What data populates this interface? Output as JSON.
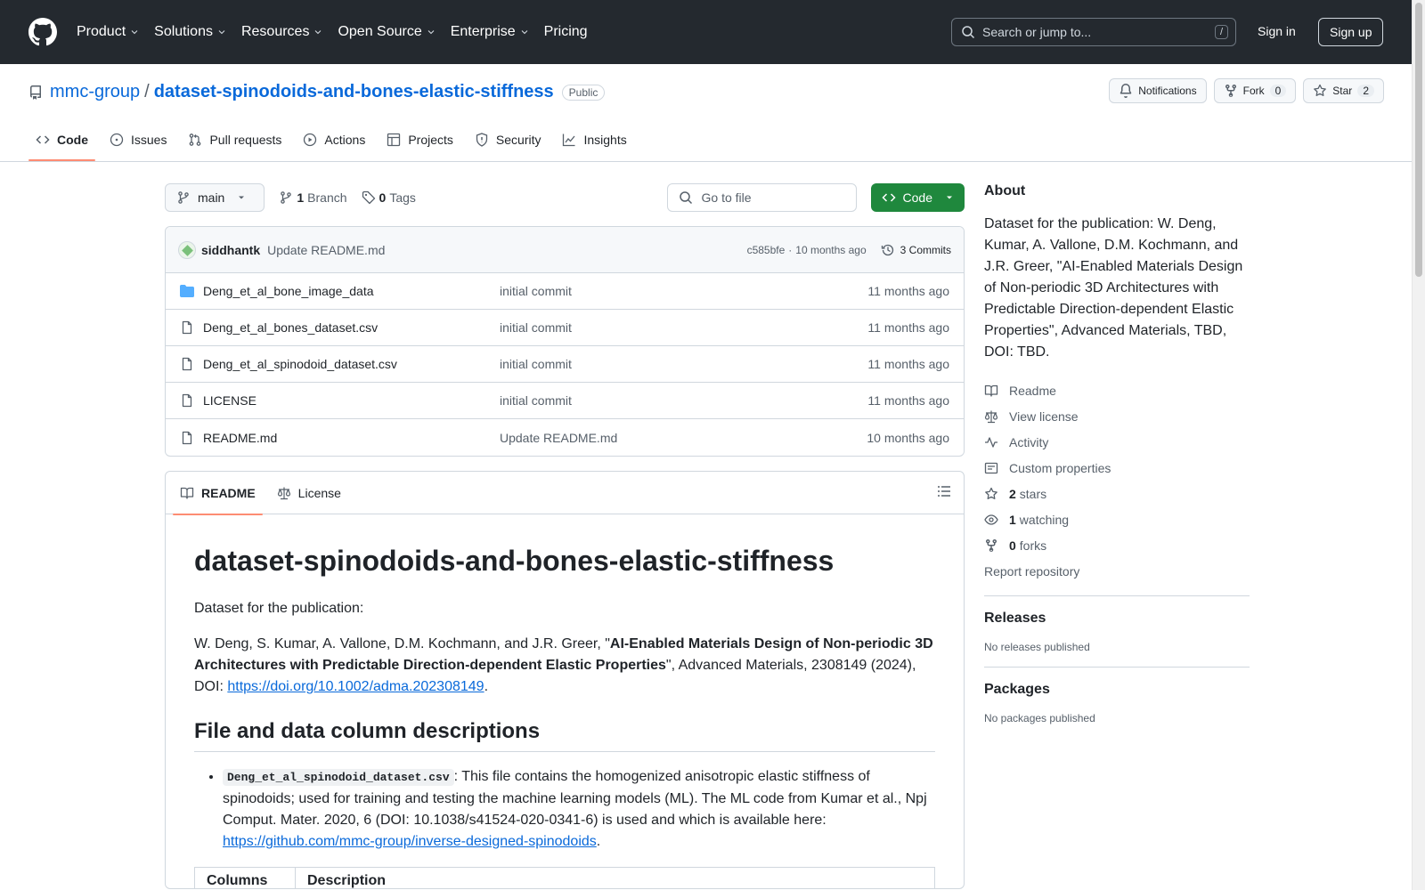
{
  "header": {
    "nav": [
      "Product",
      "Solutions",
      "Resources",
      "Open Source",
      "Enterprise",
      "Pricing"
    ],
    "search_placeholder": "Search or jump to...",
    "search_shortcut": "/",
    "sign_in": "Sign in",
    "sign_up": "Sign up"
  },
  "repo": {
    "owner": "mmc-group",
    "separator": "/",
    "name": "dataset-spinodoids-and-bones-elastic-stiffness",
    "visibility": "Public",
    "notifications_label": "Notifications",
    "fork_label": "Fork",
    "fork_count": "0",
    "star_label": "Star",
    "star_count": "2",
    "tabs": [
      "Code",
      "Issues",
      "Pull requests",
      "Actions",
      "Projects",
      "Security",
      "Insights"
    ]
  },
  "toolbar": {
    "branch": "main",
    "branch_count": "1",
    "branch_label": "Branch",
    "tag_count": "0",
    "tag_label": "Tags",
    "go_to_file": "Go to file",
    "code_button": "Code"
  },
  "commit": {
    "author": "siddhantk",
    "message": "Update README.md",
    "hash": "c585bfe",
    "dot": "·",
    "time": "10 months ago",
    "commits_label": "3 Commits"
  },
  "files": [
    {
      "name": "Deng_et_al_bone_image_data",
      "type": "folder",
      "commit": "initial commit",
      "date": "11 months ago"
    },
    {
      "name": "Deng_et_al_bones_dataset.csv",
      "type": "file",
      "commit": "initial commit",
      "date": "11 months ago"
    },
    {
      "name": "Deng_et_al_spinodoid_dataset.csv",
      "type": "file",
      "commit": "initial commit",
      "date": "11 months ago"
    },
    {
      "name": "LICENSE",
      "type": "file",
      "commit": "initial commit",
      "date": "11 months ago"
    },
    {
      "name": "README.md",
      "type": "file",
      "commit": "Update README.md",
      "date": "10 months ago"
    }
  ],
  "readme": {
    "tab_readme": "README",
    "tab_license": "License",
    "title": "dataset-spinodoids-and-bones-elastic-stiffness",
    "intro": "Dataset for the publication:",
    "citation_authors": "W. Deng, S. Kumar, A. Vallone, D.M. Kochmann, and J.R. Greer, \"",
    "citation_title": "AI-Enabled Materials Design of Non-periodic 3D Architectures with Predictable Direction-dependent Elastic Properties",
    "citation_rest": "\", Advanced Materials, 2308149 (2024), DOI: ",
    "doi_link": "https://doi.org/10.1002/adma.202308149",
    "doi_end": ".",
    "section_heading": "File and data column descriptions",
    "item_code": "Deng_et_al_spinodoid_dataset.csv",
    "item_text": ": This file contains the homogenized anisotropic elastic stiffness of spinodoids; used for training and testing the machine learning models (ML). The ML code from Kumar et al., Npj Comput. Mater. 2020, 6 (DOI: 10.1038/s41524-020-0341-6) is used and which is available here: ",
    "item_link": "https://github.com/mmc-group/inverse-designed-spinodoids",
    "item_end": ".",
    "table_col1": "Columns",
    "table_col2": "Description"
  },
  "sidebar": {
    "about_title": "About",
    "description": "Dataset for the publication: W. Deng, Kumar, A. Vallone, D.M. Kochmann, and J.R. Greer, \"AI-Enabled Materials Design of Non-periodic 3D Architectures with Predictable Direction-dependent Elastic Properties\", Advanced Materials, TBD, DOI: TBD.",
    "readme": "Readme",
    "license": "View license",
    "activity": "Activity",
    "custom_properties": "Custom properties",
    "stars_count": "2",
    "stars_label": "stars",
    "watching_count": "1",
    "watching_label": "watching",
    "forks_count": "0",
    "forks_label": "forks",
    "report": "Report repository",
    "releases_title": "Releases",
    "releases_none": "No releases published",
    "packages_title": "Packages",
    "packages_none": "No packages published"
  }
}
